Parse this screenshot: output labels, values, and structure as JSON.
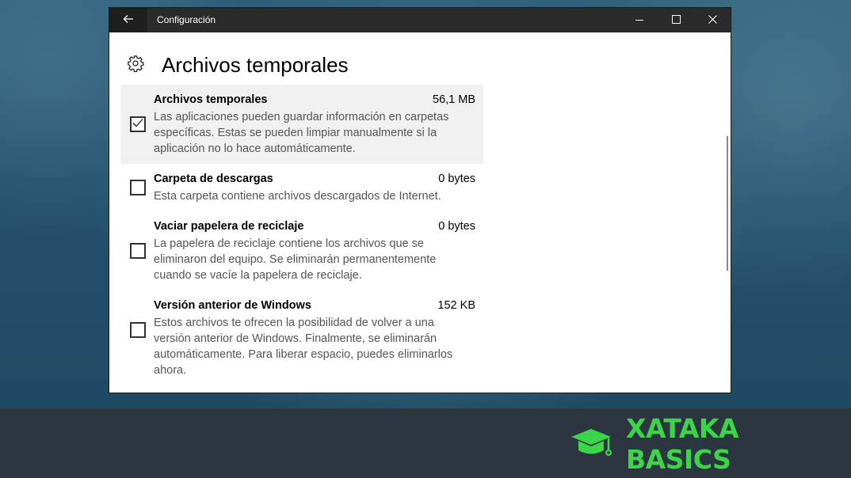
{
  "window": {
    "title": "Configuración",
    "back_icon": "arrow-left-icon",
    "controls": [
      "minimize-icon",
      "maximize-icon",
      "close-icon"
    ]
  },
  "page": {
    "title": "Archivos temporales",
    "icon": "gear-icon"
  },
  "items": [
    {
      "label": "Archivos temporales",
      "size": "56,1 MB",
      "checked": true,
      "description": "Las aplicaciones pueden guardar información en carpetas específicas. Estas se pueden limpiar manualmente si la aplicación no lo hace automáticamente."
    },
    {
      "label": "Carpeta de descargas",
      "size": "0 bytes",
      "checked": false,
      "description": "Esta carpeta contiene archivos descargados de Internet."
    },
    {
      "label": "Vaciar papelera de reciclaje",
      "size": "0 bytes",
      "checked": false,
      "description": "La papelera de reciclaje contiene los archivos que se eliminaron del equipo. Se eliminarán permanentemente cuando se vacíe la papelera de reciclaje."
    },
    {
      "label": "Versión anterior de Windows",
      "size": "152 KB",
      "checked": false,
      "description": "Estos archivos te ofrecen la posibilidad de volver a una versión anterior de Windows. Finalmente, se eliminarán automáticamente. Para liberar espacio, puedes eliminarlos ahora."
    }
  ],
  "brand": {
    "text": "XATAKA BASICS",
    "icon": "graduation-cap-icon",
    "color": "#3cd449"
  },
  "colors": {
    "titlebar": "#2b2b2b",
    "selected_row": "#f0f0f0",
    "description_text": "#555555"
  }
}
